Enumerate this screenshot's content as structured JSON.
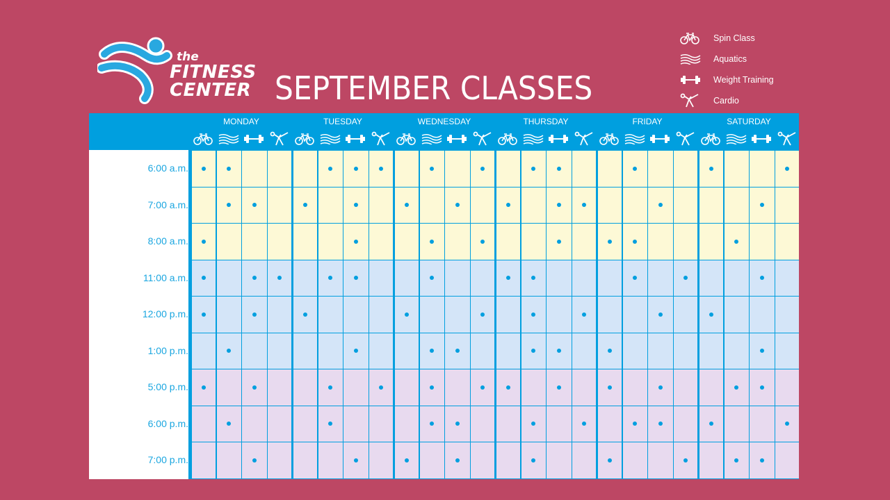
{
  "brand": {
    "the": "the",
    "line1": "FITNESS",
    "line2": "CENTER"
  },
  "title": "SEPTEMBER CLASSES",
  "colors": {
    "background": "#bd4764",
    "accent": "#009fdf",
    "morning": "#fdf9d6",
    "midday": "#d4e5f8",
    "evening": "#e8daef"
  },
  "legend": [
    {
      "icon": "bicycle-icon",
      "label": "Spin Class"
    },
    {
      "icon": "waves-icon",
      "label": "Aquatics"
    },
    {
      "icon": "dumbbell-icon",
      "label": "Weight Training"
    },
    {
      "icon": "cardio-stretch-icon",
      "label": "Cardio"
    }
  ],
  "days": [
    "MONDAY",
    "TUESDAY",
    "WEDNESDAY",
    "THURSDAY",
    "FRIDAY",
    "SATURDAY"
  ],
  "class_types": [
    "spin",
    "aquatics",
    "weight",
    "cardio"
  ],
  "times": [
    "6:00 a.m.",
    "7:00 a.m.",
    "8:00 a.m.",
    "11:00 a.m.",
    "12:00 p.m.",
    "1:00 p.m.",
    "5:00 p.m.",
    "6:00 p.m.",
    "7:00 p.m."
  ],
  "time_periods": [
    "morning",
    "morning",
    "morning",
    "midday",
    "midday",
    "midday",
    "evening",
    "evening",
    "evening"
  ],
  "schedule": [
    [
      [
        1,
        1,
        0,
        0
      ],
      [
        0,
        1,
        1,
        1
      ],
      [
        0,
        1,
        0,
        1
      ],
      [
        0,
        1,
        1,
        0
      ],
      [
        0,
        1,
        0,
        0
      ],
      [
        1,
        0,
        0,
        1
      ]
    ],
    [
      [
        0,
        1,
        1,
        0
      ],
      [
        1,
        0,
        1,
        0
      ],
      [
        1,
        0,
        1,
        0
      ],
      [
        1,
        0,
        1,
        1
      ],
      [
        0,
        0,
        1,
        0
      ],
      [
        0,
        0,
        1,
        0
      ]
    ],
    [
      [
        1,
        0,
        0,
        0
      ],
      [
        0,
        0,
        1,
        0
      ],
      [
        0,
        1,
        0,
        1
      ],
      [
        0,
        0,
        1,
        0
      ],
      [
        1,
        1,
        0,
        0
      ],
      [
        0,
        1,
        0,
        0
      ]
    ],
    [
      [
        1,
        0,
        1,
        1
      ],
      [
        0,
        1,
        1,
        0
      ],
      [
        0,
        1,
        0,
        0
      ],
      [
        1,
        1,
        0,
        0
      ],
      [
        0,
        1,
        0,
        1
      ],
      [
        0,
        0,
        1,
        0
      ]
    ],
    [
      [
        1,
        0,
        1,
        0
      ],
      [
        1,
        0,
        0,
        0
      ],
      [
        1,
        0,
        0,
        1
      ],
      [
        0,
        1,
        0,
        1
      ],
      [
        0,
        0,
        1,
        0
      ],
      [
        1,
        0,
        0,
        0
      ]
    ],
    [
      [
        0,
        1,
        0,
        0
      ],
      [
        0,
        0,
        1,
        0
      ],
      [
        0,
        1,
        1,
        0
      ],
      [
        0,
        1,
        1,
        0
      ],
      [
        1,
        0,
        0,
        0
      ],
      [
        0,
        0,
        1,
        0
      ]
    ],
    [
      [
        1,
        0,
        1,
        0
      ],
      [
        0,
        1,
        0,
        1
      ],
      [
        0,
        1,
        0,
        1
      ],
      [
        1,
        0,
        1,
        0
      ],
      [
        1,
        0,
        1,
        0
      ],
      [
        0,
        1,
        1,
        0
      ]
    ],
    [
      [
        0,
        1,
        0,
        0
      ],
      [
        0,
        1,
        0,
        0
      ],
      [
        0,
        1,
        1,
        0
      ],
      [
        0,
        1,
        0,
        1
      ],
      [
        0,
        1,
        1,
        0
      ],
      [
        1,
        0,
        0,
        1
      ]
    ],
    [
      [
        0,
        0,
        1,
        0
      ],
      [
        0,
        0,
        1,
        0
      ],
      [
        1,
        0,
        1,
        0
      ],
      [
        0,
        1,
        0,
        0
      ],
      [
        1,
        0,
        0,
        1
      ],
      [
        0,
        1,
        1,
        0
      ]
    ]
  ]
}
